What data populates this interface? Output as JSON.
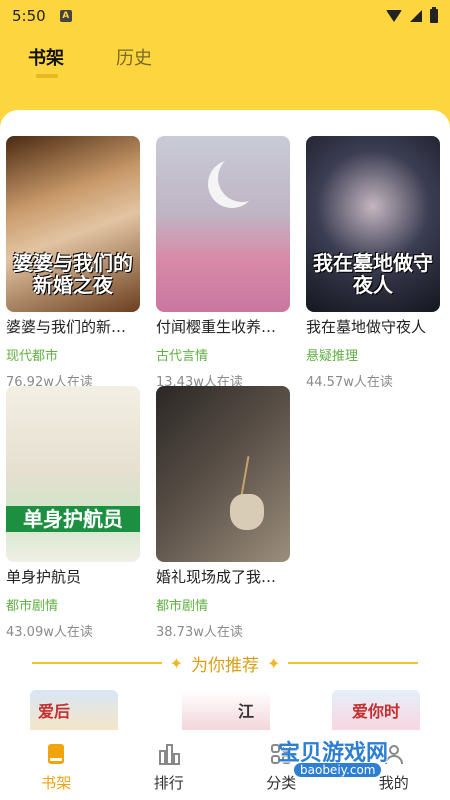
{
  "status": {
    "time": "5:50",
    "notif": "A"
  },
  "tabs": [
    {
      "label": "书架"
    },
    {
      "label": "历史"
    }
  ],
  "books": [
    {
      "title": "婆婆与我们的新婚之夜",
      "cover_text": "婆婆与我们的新婚之夜",
      "genre": "现代都市",
      "readers": "76.92w人在读"
    },
    {
      "title": "付闻樱重生收养宋焰",
      "cover_text": "",
      "genre": "古代言情",
      "readers": "13.43w人在读"
    },
    {
      "title": "我在墓地做守夜人",
      "cover_text": "我在墓地做守夜人",
      "genre": "悬疑推理",
      "readers": "44.57w人在读"
    },
    {
      "title": "单身护航员",
      "cover_text": "单身护航员",
      "genre": "都市剧情",
      "readers": "43.09w人在读"
    },
    {
      "title": "婚礼现场成了我们的告别",
      "cover_text": "",
      "genre": "都市剧情",
      "readers": "38.73w人在读"
    }
  ],
  "recommend": {
    "title": "为你推荐"
  },
  "recs": [
    {
      "text": "爱后"
    },
    {
      "text": "江"
    },
    {
      "text": "爱你时"
    }
  ],
  "nav": [
    {
      "label": "书架",
      "icon": "book-icon"
    },
    {
      "label": "排行",
      "icon": "chart-bars-icon"
    },
    {
      "label": "分类",
      "icon": "grid-icon"
    },
    {
      "label": "我的",
      "icon": "user-icon"
    }
  ],
  "watermark": {
    "text": "宝贝游戏网",
    "url": "baobeiy.com"
  },
  "colors": {
    "accent": "#fcd53f",
    "nav_active": "#f2a40f",
    "genre": "#5fb043"
  }
}
